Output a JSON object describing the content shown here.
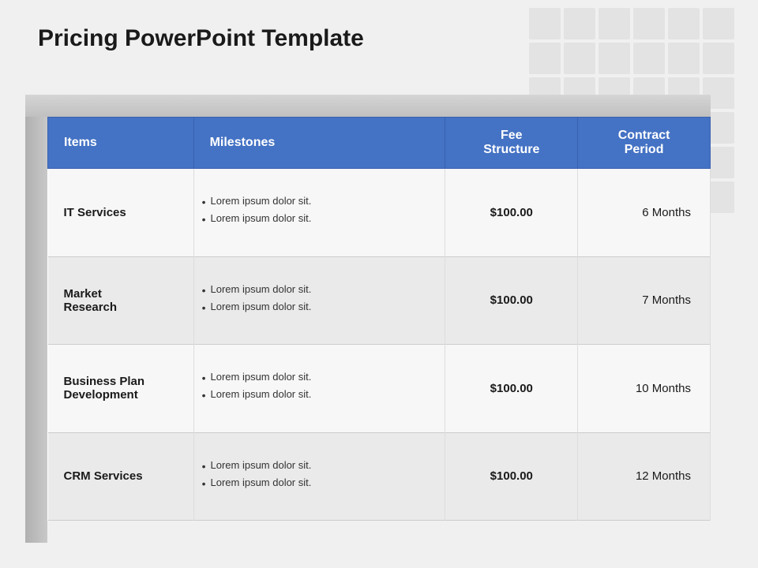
{
  "page": {
    "title": "Pricing PowerPoint Template"
  },
  "table": {
    "headers": [
      {
        "key": "items",
        "label": "Items"
      },
      {
        "key": "milestones",
        "label": "Milestones"
      },
      {
        "key": "fee_structure",
        "label": "Fee\nStructure"
      },
      {
        "key": "contract_period",
        "label": "Contract\nPeriod"
      }
    ],
    "rows": [
      {
        "item": "IT Services",
        "milestones": [
          "Lorem ipsum dolor sit.",
          "Lorem ipsum dolor sit."
        ],
        "fee": "$100.00",
        "contract": "6 Months"
      },
      {
        "item": "Market\nResearch",
        "milestones": [
          "Lorem ipsum dolor sit.",
          "Lorem ipsum dolor sit."
        ],
        "fee": "$100.00",
        "contract": "7 Months"
      },
      {
        "item": "Business Plan\nDevelopment",
        "milestones": [
          "Lorem ipsum dolor sit.",
          "Lorem ipsum dolor sit."
        ],
        "fee": "$100.00",
        "contract": "10 Months"
      },
      {
        "item": "CRM Services",
        "milestones": [
          "Lorem ipsum dolor sit.",
          "Lorem ipsum dolor sit."
        ],
        "fee": "$100.00",
        "contract": "12 Months"
      }
    ]
  }
}
